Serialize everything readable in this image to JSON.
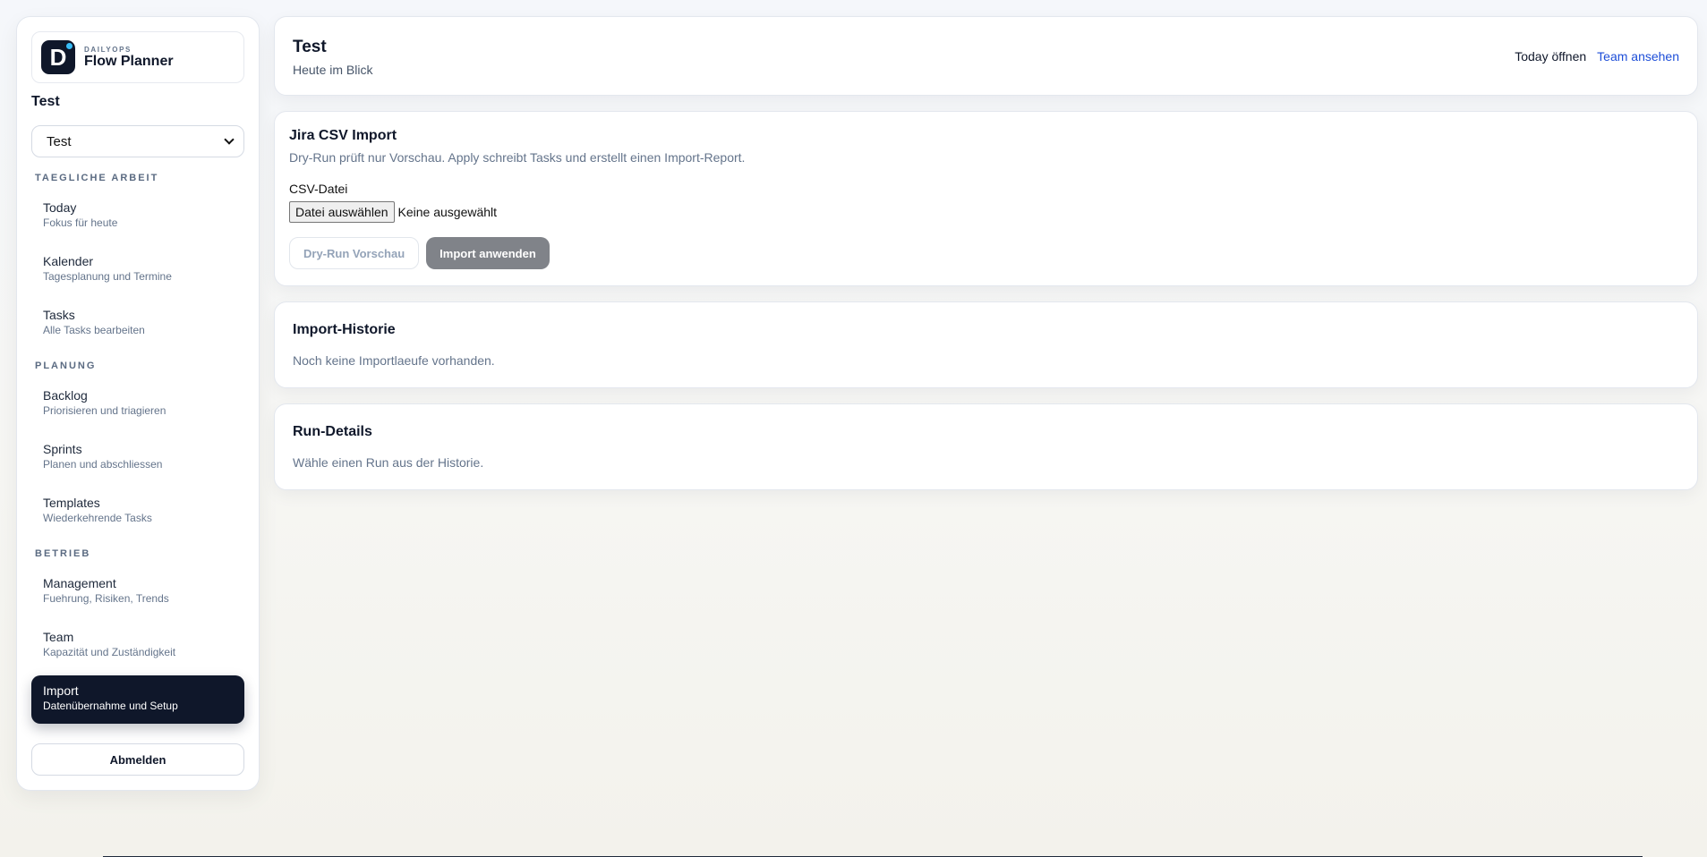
{
  "brand": {
    "kicker": "DAILYOPS",
    "name": "Flow Planner",
    "logo_letter": "D"
  },
  "workspace": {
    "title": "Test",
    "selected": "Test"
  },
  "sidebar": {
    "sections": [
      {
        "label": "TAEGLICHE ARBEIT",
        "items": [
          {
            "label": "Today",
            "sub": "Fokus für heute"
          },
          {
            "label": "Kalender",
            "sub": "Tagesplanung und Termine"
          },
          {
            "label": "Tasks",
            "sub": "Alle Tasks bearbeiten"
          }
        ]
      },
      {
        "label": "PLANUNG",
        "items": [
          {
            "label": "Backlog",
            "sub": "Priorisieren und triagieren"
          },
          {
            "label": "Sprints",
            "sub": "Planen und abschliessen"
          },
          {
            "label": "Templates",
            "sub": "Wiederkehrende Tasks"
          }
        ]
      },
      {
        "label": "BETRIEB",
        "items": [
          {
            "label": "Management",
            "sub": "Fuehrung, Risiken, Trends"
          },
          {
            "label": "Team",
            "sub": "Kapazität und Zuständigkeit"
          },
          {
            "label": "Import",
            "sub": "Datenübernahme und Setup"
          }
        ]
      }
    ],
    "logout": "Abmelden"
  },
  "header": {
    "title": "Test",
    "subtitle": "Heute im Blick",
    "action_today": "Today öffnen",
    "action_team": "Team ansehen"
  },
  "import": {
    "title": "Jira CSV Import",
    "description": "Dry-Run prüft nur Vorschau. Apply schreibt Tasks und erstellt einen Import-Report.",
    "file_label": "CSV-Datei",
    "file_button": "Datei auswählen",
    "file_status": "Keine ausgewählt",
    "dry_run_button": "Dry-Run Vorschau",
    "apply_button": "Import anwenden"
  },
  "history": {
    "title": "Import-Historie",
    "empty": "Noch keine Importlaeufe vorhanden."
  },
  "run_details": {
    "title": "Run-Details",
    "empty": "Wähle einen Run aus der Historie."
  },
  "colors": {
    "accent_dark": "#0f172a",
    "link_blue": "#1d4ed8",
    "brand_dot": "#38bdf8"
  }
}
